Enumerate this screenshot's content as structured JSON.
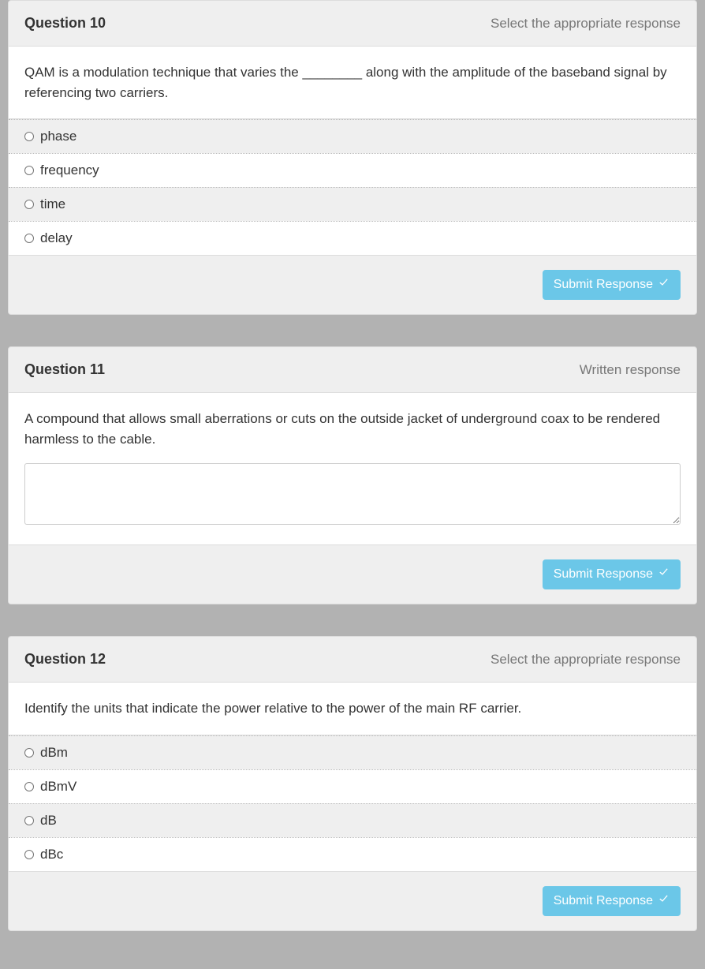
{
  "questions": [
    {
      "title": "Question 10",
      "type_label": "Select the appropriate response",
      "type": "single_choice",
      "prompt": "QAM is a modulation technique that varies the ________ along with the amplitude of the baseband signal by referencing two carriers.",
      "options": [
        "phase",
        "frequency",
        "time",
        "delay"
      ],
      "submit_label": "Submit Response"
    },
    {
      "title": "Question 11",
      "type_label": "Written response",
      "type": "written",
      "prompt": "A compound that allows small aberrations or cuts on the outside jacket of underground coax to be rendered harmless to the cable.",
      "value": "",
      "submit_label": "Submit Response"
    },
    {
      "title": "Question 12",
      "type_label": "Select the appropriate response",
      "type": "single_choice",
      "prompt": "Identify the units that indicate the power relative to the power of the main RF carrier.",
      "options": [
        "dBm",
        "dBmV",
        "dB",
        "dBc"
      ],
      "submit_label": "Submit Response"
    }
  ]
}
